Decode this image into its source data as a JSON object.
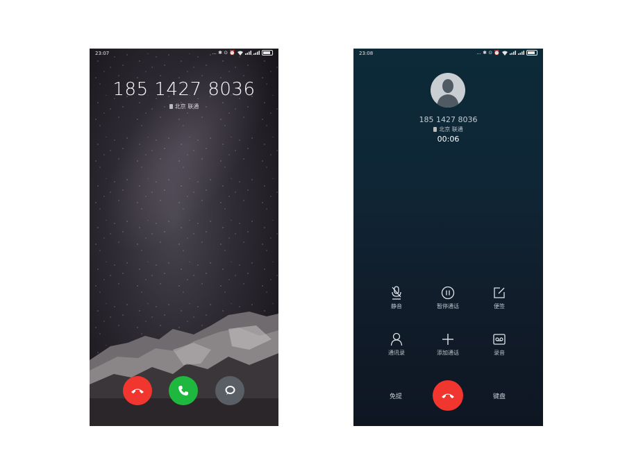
{
  "incoming": {
    "status_time": "23:07",
    "status_icons": "... ✱ ⊙ ⏰",
    "phone_number": "185 1427 8036",
    "location": "北京 联通",
    "colors": {
      "decline": "#f0362f",
      "answer": "#1fb83e",
      "message": "#5a5f66"
    },
    "icons": [
      "hangup-icon",
      "phone-icon",
      "message-bubble-icon"
    ]
  },
  "incall": {
    "status_time": "23:08",
    "status_icons": "... ✱ ⊙ ⏰",
    "phone_number": "185 1427 8036",
    "location": "北京 联通",
    "duration": "00:06",
    "controls": [
      {
        "label": "静音",
        "icon": "mute-icon"
      },
      {
        "label": "暂停通话",
        "icon": "pause-icon"
      },
      {
        "label": "便签",
        "icon": "note-icon"
      },
      {
        "label": "通讯录",
        "icon": "contacts-icon"
      },
      {
        "label": "添加通话",
        "icon": "add-icon"
      },
      {
        "label": "录音",
        "icon": "record-icon"
      }
    ],
    "speaker_label": "免提",
    "keypad_label": "键盘",
    "colors": {
      "hangup": "#f0362f",
      "background": "#0f2636"
    }
  }
}
